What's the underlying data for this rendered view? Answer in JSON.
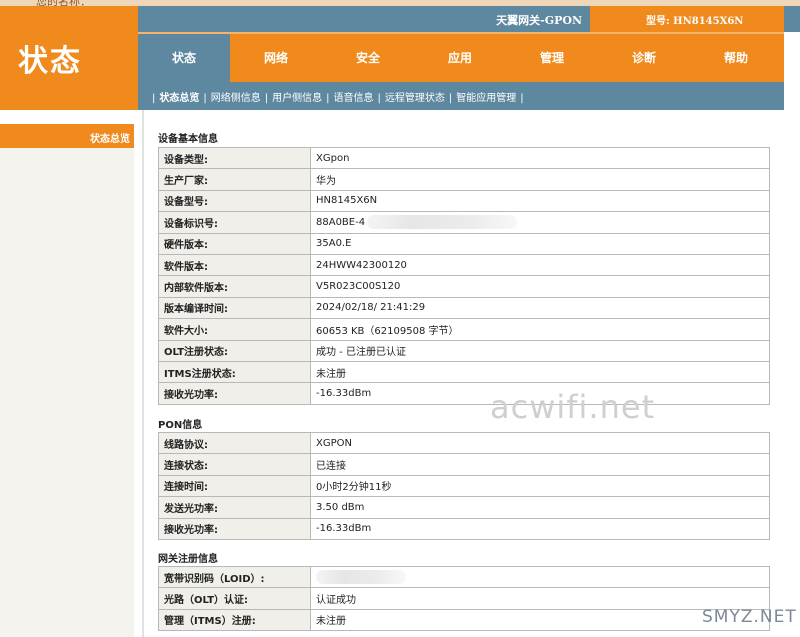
{
  "top_strip": {
    "partial_text": "您的名称："
  },
  "logo": {
    "title": "状态"
  },
  "header": {
    "gateway_name": "天翼网关-GPON",
    "model": "型号: HN8145X6N"
  },
  "nav": {
    "tabs": [
      {
        "label": "状态",
        "active": true
      },
      {
        "label": "网络",
        "active": false
      },
      {
        "label": "安全",
        "active": false
      },
      {
        "label": "应用",
        "active": false
      },
      {
        "label": "管理",
        "active": false
      },
      {
        "label": "诊断",
        "active": false
      },
      {
        "label": "帮助",
        "active": false
      }
    ]
  },
  "subnav": {
    "items": [
      {
        "label": "状态总览",
        "active": true
      },
      {
        "label": "网络侧信息",
        "active": false
      },
      {
        "label": "用户侧信息",
        "active": false
      },
      {
        "label": "语音信息",
        "active": false
      },
      {
        "label": "远程管理状态",
        "active": false
      },
      {
        "label": "智能应用管理",
        "active": false
      }
    ]
  },
  "sidebar": {
    "items": [
      {
        "label": "状态总览",
        "active": true
      }
    ]
  },
  "sections": {
    "basic": {
      "title": "设备基本信息",
      "rows": [
        {
          "key": "设备类型:",
          "value": "XGpon"
        },
        {
          "key": "生产厂家:",
          "value": "华为"
        },
        {
          "key": "设备型号:",
          "value": "HN8145X6N"
        },
        {
          "key": "设备标识号:",
          "value": "88A0BE-4"
        },
        {
          "key": "硬件版本:",
          "value": "35A0.E"
        },
        {
          "key": "软件版本:",
          "value": "24HWW42300120"
        },
        {
          "key": "内部软件版本:",
          "value": "V5R023C00S120"
        },
        {
          "key": "版本编译时间:",
          "value": "2024/02/18/ 21:41:29"
        },
        {
          "key": "软件大小:",
          "value": "60653 KB（62109508 字节）"
        },
        {
          "key": "OLT注册状态:",
          "value": "成功 - 已注册已认证"
        },
        {
          "key": "ITMS注册状态:",
          "value": "未注册"
        },
        {
          "key": "接收光功率:",
          "value": "-16.33dBm"
        }
      ]
    },
    "pon": {
      "title": "PON信息",
      "rows": [
        {
          "key": "线路协议:",
          "value": "XGPON"
        },
        {
          "key": "连接状态:",
          "value": "已连接"
        },
        {
          "key": "连接时间:",
          "value": "0小时2分钟11秒"
        },
        {
          "key": "发送光功率:",
          "value": "3.50 dBm"
        },
        {
          "key": "接收光功率:",
          "value": "-16.33dBm"
        }
      ]
    },
    "reg": {
      "title": "网关注册信息",
      "rows": [
        {
          "key": "宽带识别码（LOID）:",
          "value": ""
        },
        {
          "key": "光路（OLT）认证:",
          "value": "认证成功"
        },
        {
          "key": "管理（ITMS）注册:",
          "value": "未注册"
        }
      ]
    }
  },
  "watermarks": {
    "center": "acwifi.net",
    "corner": "SMYZ.NET"
  },
  "colors": {
    "orange": "#f08a1c",
    "steel_blue": "#5e88a0",
    "label_bg": "#f0efe9"
  }
}
